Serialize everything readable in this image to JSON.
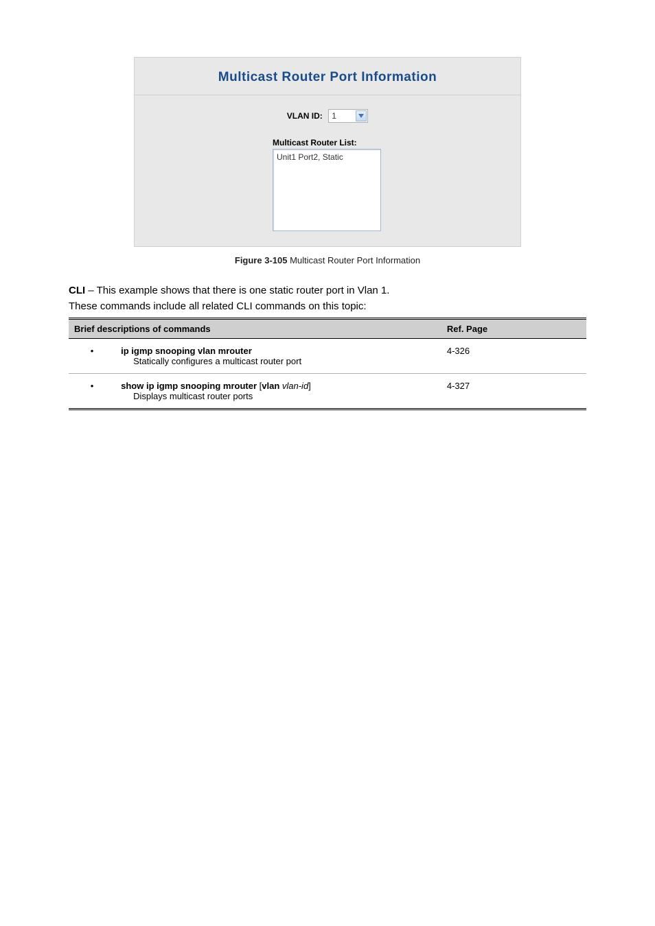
{
  "panel": {
    "title": "Multicast Router Port Information",
    "vlan_label": "VLAN ID:",
    "vlan_value": "1",
    "list_label": "Multicast Router List:",
    "list_item": "Unit1 Port2, Static"
  },
  "figure": {
    "prefix": "Figure 3-105  ",
    "text": "Multicast Router Port Information"
  },
  "cli": {
    "intro_prefix": "CLI",
    "intro_text": " – This example shows that there is one static router port in Vlan 1.",
    "commands_line": "These commands include all related CLI commands on this topic:",
    "header_brief": "Brief descriptions of commands",
    "header_page": "Ref. Page",
    "rows": [
      {
        "cmd_kw": "ip igmp snooping vlan mrouter",
        "brief": "Statically configures a multicast router port",
        "page": "4-326"
      },
      {
        "cmd_kw": "show ip igmp snooping mrouter ",
        "cmd_pre_open": "[",
        "cmd_sub_kw": "vlan ",
        "cmd_arg": "vlan-id",
        "cmd_post_close": "]",
        "brief": "Displays multicast router ports",
        "page": "4-327"
      }
    ]
  }
}
